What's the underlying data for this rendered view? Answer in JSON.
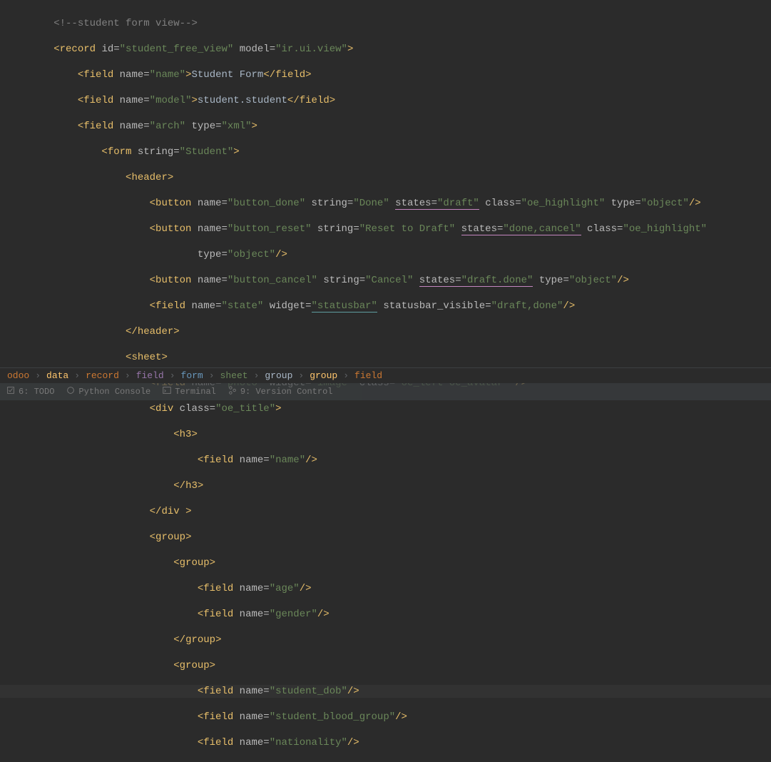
{
  "code": {
    "l1": "        <!--student form view-->",
    "l2_indent": "        ",
    "l2_open": "<",
    "l2_tag": "record ",
    "l2_attr1n": "id",
    "l2_eq": "=",
    "l2_attr1v": "\"student_free_view\"",
    "l2_sp": " ",
    "l2_attr2n": "model",
    "l2_attr2v": "\"ir.ui.view\"",
    "l2_close": ">",
    "l3_indent": "            ",
    "l3_open": "<",
    "l3_tag": "field ",
    "l3_attrn": "name",
    "l3_attrv": "\"name\"",
    "l3_close": ">",
    "l3_content": "Student Form",
    "l3_ctag_open": "</",
    "l3_ctag": "field",
    "l3_ctag_close": ">",
    "l4_attrv": "\"model\"",
    "l4_content": "student.student",
    "l5_attrv": "\"arch\"",
    "l5_attr2n": "type",
    "l5_attr2v": "\"xml\"",
    "l6_indent": "                ",
    "l6_tag": "form ",
    "l6_attrn": "string",
    "l6_attrv": "\"Student\"",
    "l7_indent": "                    ",
    "l7_tag": "header",
    "l8_indent": "                        ",
    "l8_tag": "button ",
    "l8_a1v": "\"button_done\"",
    "l8_a2n": "string",
    "l8_a2v": "\"Done\"",
    "l8_a3n": "states",
    "l8_a3v": "\"draft\"",
    "l8_a4n": "class",
    "l8_a4v": "\"oe_highlight\"",
    "l8_a5n": "type",
    "l8_a5v": "\"object\"",
    "l8_selfclose": "/>",
    "l9_a1v": "\"button_reset\"",
    "l9_a2v": "\"Reset to Draft\"",
    "l9_a3v": "\"done,cancel\"",
    "l10_indent": "                                ",
    "l11_a1v": "\"button_cancel\"",
    "l11_a2v": "\"Cancel\"",
    "l11_a3v": "\"draft.done\"",
    "l12_a1v": "\"state\"",
    "l12_a2n": "widget",
    "l12_a2v": "\"statusbar\"",
    "l12_a3n": "statusbar_visible",
    "l12_a3v": "\"draft,done\"",
    "l13_close": "</",
    "l14_tag": "sheet",
    "l15_a1v": "\"photo\"",
    "l15_a2v": "\"image\"",
    "l15_a3v": "\"oe_left oe_avatar\"",
    "l15_sp": " ",
    "l16_tag": "div ",
    "l16_a1v": "\"oe_title\"",
    "l17_indent": "                            ",
    "l17_tag": "h3",
    "l18_indent": "                                ",
    "l18_a1v": "\"name\"",
    "l22_tag": "group",
    "l24_a1v": "\"age\"",
    "l25_a1v": "\"gender\"",
    "l28_a1v": "\"student_dob\"",
    "l29_a1v": "\"student_blood_group\"",
    "l30_a1v": "\"nationality\""
  },
  "breadcrumb": {
    "items": [
      "odoo",
      "data",
      "record",
      "field",
      "form",
      "sheet",
      "group",
      "group",
      "field"
    ],
    "sep": "›"
  },
  "toolbar": {
    "todo": "6: TODO",
    "pyconsole": "Python Console",
    "terminal": "Terminal",
    "vcs": "9: Version Control"
  }
}
